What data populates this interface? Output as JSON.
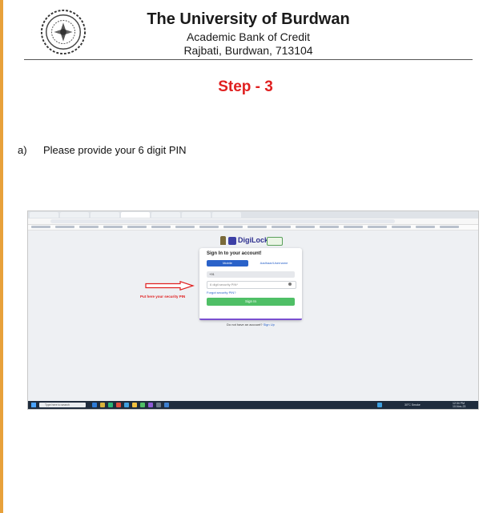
{
  "header": {
    "university": "The University of Burdwan",
    "line1": "Academic Bank of Credit",
    "line2": "Rajbati, Burdwan, 713104"
  },
  "step": "Step - 3",
  "instruction": {
    "marker": "a)",
    "text": "Please provide your 6 digit PIN"
  },
  "screenshot": {
    "logo_text": "DigiLocker",
    "card_title": "Sign In to your account!",
    "tab_mobile": "Mobile",
    "tab_aadhaar": "Aadhaar/Username",
    "field_value": "+91",
    "pin_placeholder": "6 digit security PIN*",
    "forgot_pin": "Forgot security PIN?",
    "sign_in": "Sign In",
    "no_account": "Do not have an account?",
    "sign_up": "Sign Up",
    "annotation": "Put here your security PIN",
    "taskbar_search": "Type here to search",
    "weather": "30°C Smoke",
    "time": "12:34 PM",
    "date": "10-Nov-23"
  },
  "colors": {
    "step": "#e02020",
    "accent_border": "#e8a13a",
    "signin_button": "#4fbf66",
    "mobile_tab": "#2a62c9"
  }
}
